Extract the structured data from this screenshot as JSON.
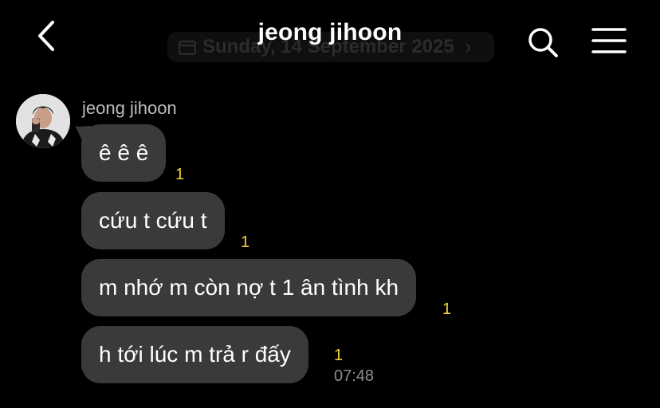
{
  "header": {
    "title": "jeong jihoon",
    "date_label": "Sunday, 14 September 2025"
  },
  "conversation": {
    "sender_name": "jeong jihoon",
    "messages": [
      {
        "text": "ê ê ê",
        "unread": "1"
      },
      {
        "text": "cứu t cứu t",
        "unread": "1"
      },
      {
        "text": "m nhớ m còn nợ t 1 ân tình kh",
        "unread": "1"
      },
      {
        "text": "h tới lúc m trả r đấy",
        "unread": "1",
        "time": "07:48"
      }
    ]
  },
  "icons": {
    "back": "chevron-left-icon",
    "search": "search-icon",
    "menu": "hamburger-menu-icon",
    "date": "calendar-icon"
  },
  "colors": {
    "background": "#000000",
    "bubble": "#3a3a3c",
    "unread_count": "#f4d23c",
    "timestamp": "#8e8e93"
  }
}
